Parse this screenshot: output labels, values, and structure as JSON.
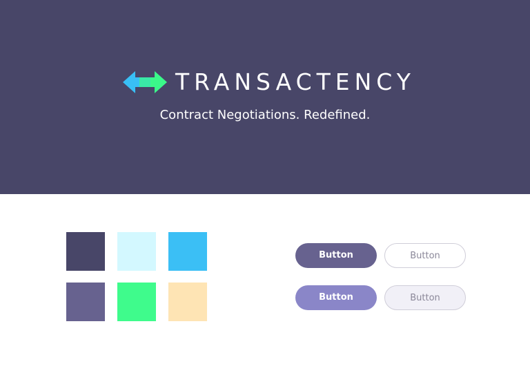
{
  "brand": {
    "name": "TRANSACTENCY",
    "tagline": "Contract Negotiations. Redefined.",
    "logo_icon": "double-arrow-icon",
    "logo_colors": [
      "#39bff5",
      "#3bf98a"
    ]
  },
  "colors": {
    "hero_background": "#484668"
  },
  "swatches": [
    {
      "color": "#484668"
    },
    {
      "color": "#d3f8ff"
    },
    {
      "color": "#3bbff5"
    },
    {
      "color": "#67628f"
    },
    {
      "color": "#3ffb8c"
    },
    {
      "color": "#fee4b4"
    }
  ],
  "buttons": {
    "primary": {
      "label": "Button",
      "color": "#67628f"
    },
    "outline": {
      "label": "Button",
      "color": "#ffffff"
    },
    "primary_light": {
      "label": "Button",
      "color": "#8a86c8"
    },
    "outline_light": {
      "label": "Button",
      "color": "#f1f0f7"
    }
  }
}
